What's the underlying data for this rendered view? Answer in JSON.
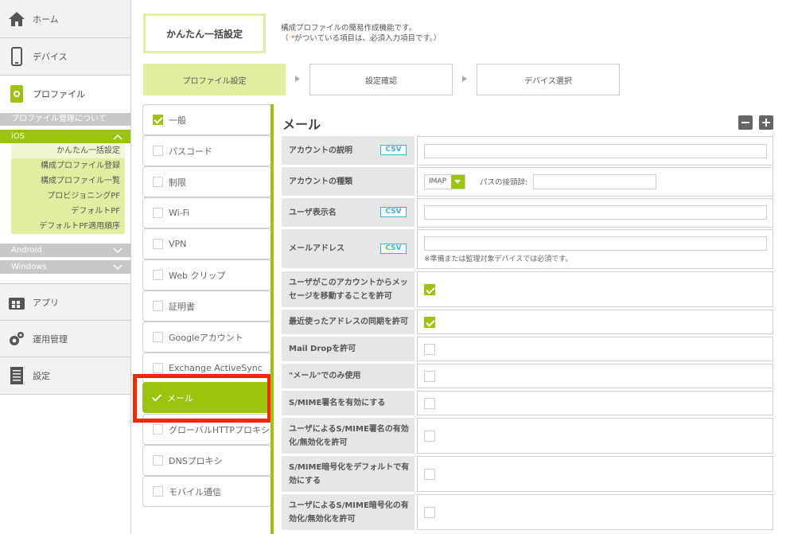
{
  "sidebar": {
    "home": "ホーム",
    "device": "デバイス",
    "profile": "プロファイル",
    "profile_about": "プロファイル管理について",
    "ios": "iOS",
    "ios_items": [
      "かんたん一括設定",
      "構成プロファイル登録",
      "構成プロファイル一覧",
      "プロビジョニングPF",
      "デフォルトPF",
      "デフォルトPF適用順序"
    ],
    "android": "Android",
    "windows": "Windows",
    "apps": "アプリ",
    "ops": "運用管理",
    "settings": "設定"
  },
  "header": {
    "title": "かんたん一括設定",
    "desc_line1": "構成プロファイルの簡易作成機能です。",
    "desc_line2_pre": "（ ",
    "desc_line2_req": "*",
    "desc_line2_post": "がついている項目は、必須入力項目です。）"
  },
  "steps": [
    "プロファイル設定",
    "設定確認",
    "デバイス選択"
  ],
  "categories": [
    "一般",
    "パスコード",
    "制限",
    "Wi-Fi",
    "VPN",
    "Web クリップ",
    "証明書",
    "Googleアカウント",
    "Exchange ActiveSync",
    "メール",
    "グローバルHTTPプロキシ",
    "DNSプロキシ",
    "モバイル通信"
  ],
  "form": {
    "title": "メール",
    "csv": "CSV",
    "account_desc": "アカウントの説明",
    "account_type": "アカウントの種類",
    "account_type_value": "IMAP",
    "path_prefix_label": "パスの接頭辞:",
    "user_display_name": "ユーザ表示名",
    "email_address": "メールアドレス",
    "email_note": "※準備または監理対象デバイスでは必須です。",
    "allow_move": "ユーザがこのアカウントからメッセージを移動することを許可",
    "recent_sync": "最近使ったアドレスの同期を許可",
    "mail_drop": "Mail Dropを許可",
    "mail_only": "\"メール\"でのみ使用",
    "smime_sign": "S/MIME署名を有効にする",
    "smime_sign_user": "ユーザによるS/MIME署名の有効化/無効化を許可",
    "smime_enc_default": "S/MIME暗号化をデフォルトで有効にする",
    "smime_enc_user": "ユーザによるS/MIME暗号化の有効化/無効化を許可"
  }
}
